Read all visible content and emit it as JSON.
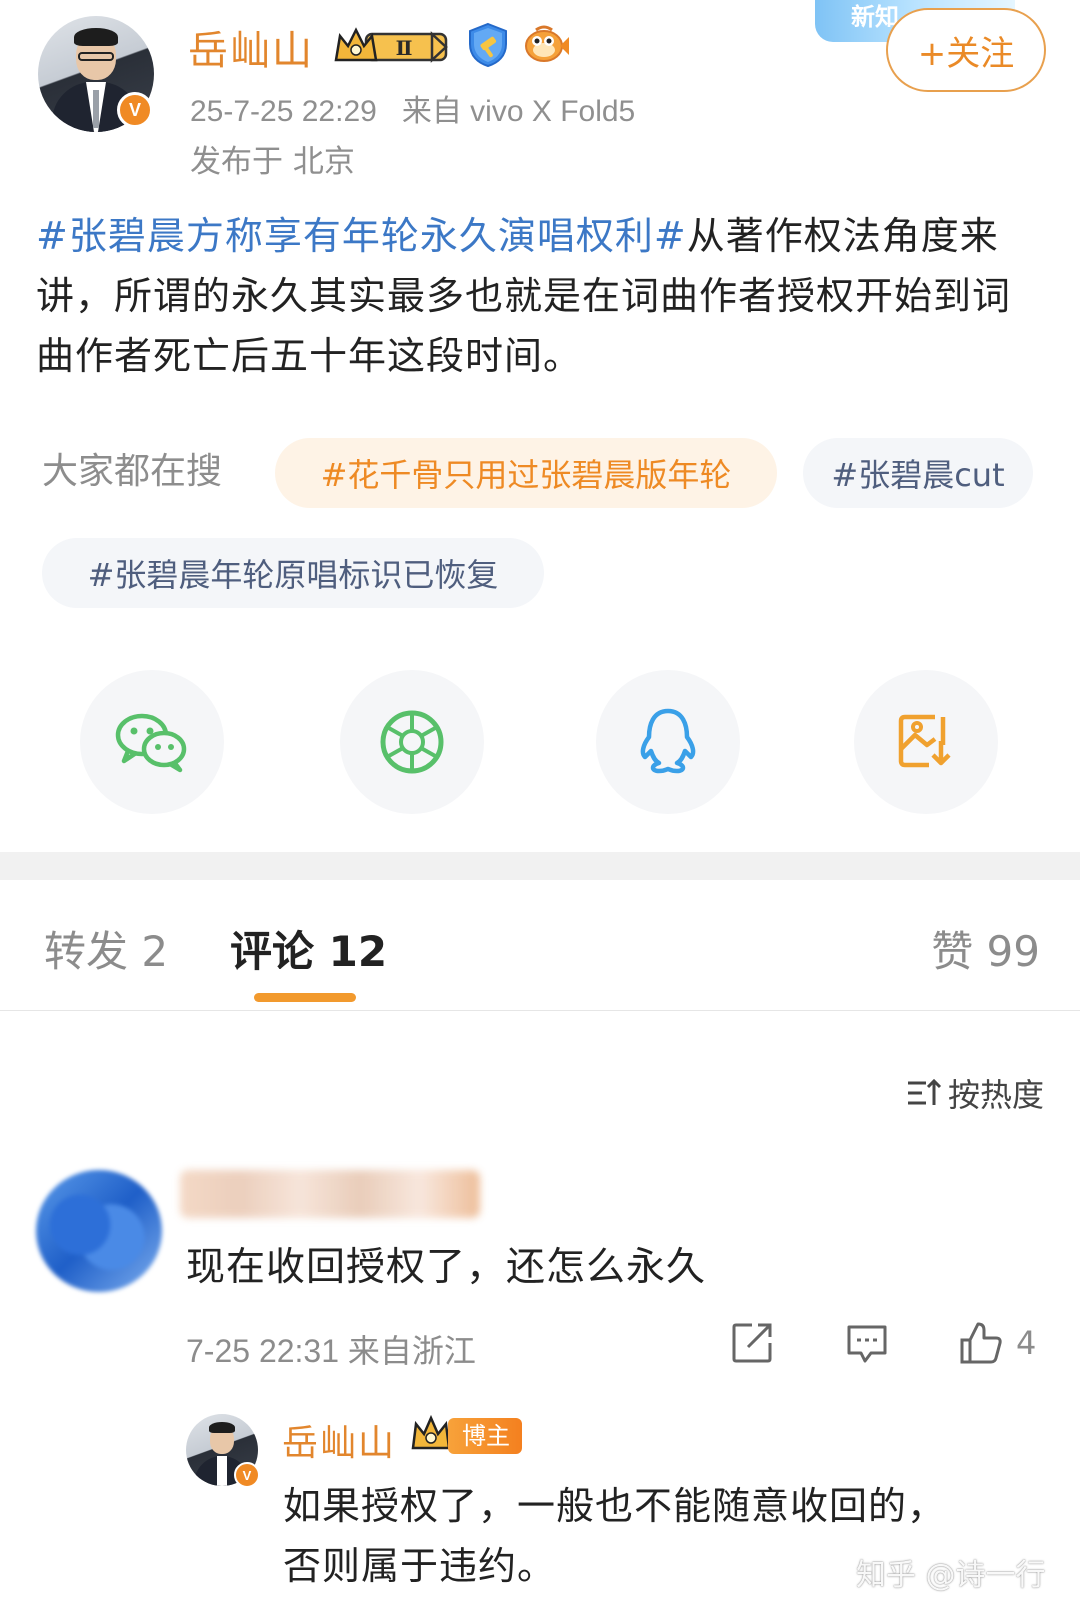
{
  "author": {
    "name": "岳屾山",
    "timestamp": "25-7-25 22:29",
    "source": "来自 vivo X Fold5",
    "location": "发布于 北京",
    "verified_mark": "V",
    "level_badge": "Ⅱ"
  },
  "banner": {
    "label": "新知"
  },
  "follow_button": {
    "label": "+关注"
  },
  "post": {
    "hashtag": "#张碧晨方称享有年轮永久演唱权利#",
    "body": "从著作权法角度来讲，所谓的永久其实最多也就是在词曲作者授权开始到词曲作者死亡后五十年这段时间。"
  },
  "search": {
    "label": "大家都在搜",
    "chips": [
      "#花千骨只用过张碧晨版年轮",
      "#张碧晨cut",
      "#张碧晨年轮原唱标识已恢复"
    ]
  },
  "share_icons": [
    "wechat-icon",
    "moments-icon",
    "qq-icon",
    "save-image-icon"
  ],
  "tabs": {
    "repost": "转发 2",
    "comments": "评论 12",
    "likes": "赞 99"
  },
  "sort": {
    "label": "按热度"
  },
  "comment": {
    "text": "现在收回授权了，还怎么永久",
    "meta": "7-25 22:31 来自浙江",
    "like_count": "4"
  },
  "reply": {
    "name": "岳屾山",
    "badge": "博主",
    "verified_mark": "V",
    "text": "如果授权了，一般也不能随意收回的，否则属于违约。"
  },
  "watermark": "知乎 @诗一行",
  "colors": {
    "accent_orange": "#e2862d",
    "hashtag_blue": "#3c78c6",
    "chip_text": "#4f5e7e",
    "tab_indicator": "#f29a2e"
  }
}
